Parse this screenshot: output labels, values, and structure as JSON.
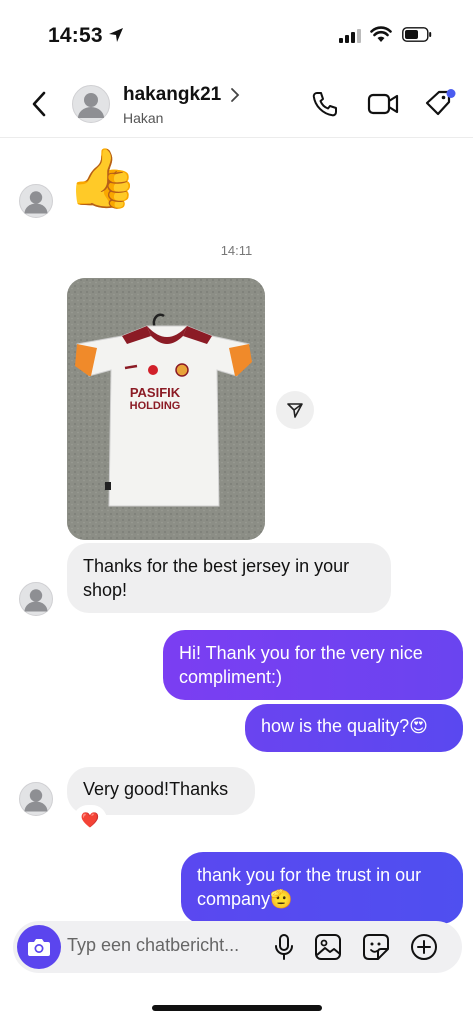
{
  "status": {
    "time": "14:53"
  },
  "header": {
    "username": "hakangk21",
    "subname": "Hakan",
    "icons": [
      "back-arrow-icon",
      "phone-icon",
      "video-camera-icon",
      "tag-icon"
    ]
  },
  "messages": {
    "first_emoji": "👍",
    "timestamp": "14:11",
    "incoming_1": "Thanks for the best jersey in your shop!",
    "outgoing_1": "Hi! Thank you for the very nice compliment:)",
    "outgoing_2": "how is the quality?😍",
    "incoming_2": "Very good!Thanks",
    "reaction": "❤️",
    "outgoing_3": "thank you for the trust in our company🫡"
  },
  "photo": {
    "sponsor_line1": "PASIFIK",
    "sponsor_line2": "HOLDING"
  },
  "composer": {
    "placeholder": "Typ een chatbericht..."
  },
  "colors": {
    "accent": "#5b45ee",
    "bubble_gradient_start": "#7a3df2",
    "bubble_gradient_end": "#4f4ff0",
    "incoming_bubble": "#efeff0",
    "notification_dot": "#4a5cf0"
  }
}
